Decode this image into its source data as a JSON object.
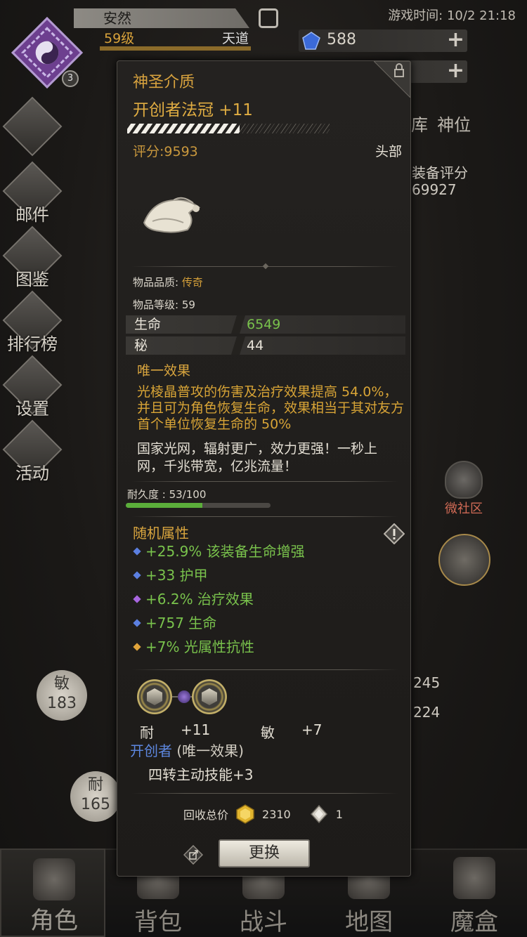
{
  "header": {
    "player_name": "安然",
    "level": "59级",
    "rank": "天道",
    "avatar_badge": "3",
    "game_time": "游戏时间: 10/2 21:18",
    "gems": "588"
  },
  "side_menu": [
    {
      "label": ""
    },
    {
      "label": "邮件"
    },
    {
      "label": "图鉴"
    },
    {
      "label": "排行榜"
    },
    {
      "label": "设置"
    },
    {
      "label": "活动"
    }
  ],
  "tabs": [
    "库",
    "神位"
  ],
  "equip_score": {
    "label": "装备评分",
    "value": "69927"
  },
  "bg_stats": {
    "agi": {
      "label": "敏",
      "value": "183"
    },
    "end": {
      "label": "耐",
      "value": "165"
    },
    "right1": "245",
    "right2": "224"
  },
  "community": {
    "label": "微社区"
  },
  "bottom_nav": [
    {
      "label": "角色"
    },
    {
      "label": "背包"
    },
    {
      "label": "战斗"
    },
    {
      "label": "地图"
    },
    {
      "label": "魔盒"
    }
  ],
  "item": {
    "quality_label": "神圣介质",
    "name": "开创者法冠 +11",
    "score": "评分:9593",
    "slot": "头部",
    "quality_line_label": "物品品质: ",
    "quality_value": "传奇",
    "item_level": "物品等级: 59",
    "stats": [
      {
        "name": "生命",
        "value": "6549",
        "color": "#79c24c"
      },
      {
        "name": "秘",
        "value": "44",
        "color": "#e8e3d8"
      }
    ],
    "unique_title": "唯一效果",
    "unique_desc": "光棱晶普攻的伤害及治疗效果提高 54.0%，并且可为角色恢复生命，效果相当于其对友方首个单位恢复生命的 50%",
    "flavor": "国家光网，辐射更广，效力更强！一秒上网，千兆带宽，亿兆流量！",
    "durability": "耐久度 : 53/100",
    "durability_fraction": 0.53,
    "random_title": "随机属性",
    "random_attrs": [
      {
        "text": "+25.9% 该装备生命增强",
        "dot": "#5b7fe0"
      },
      {
        "text": "+33 护甲",
        "dot": "#5b7fe0"
      },
      {
        "text": "+6.2% 治疗效果",
        "dot": "#a866e0"
      },
      {
        "text": "+757 生命",
        "dot": "#5b7fe0"
      },
      {
        "text": "+7% 光属性抗性",
        "dot": "#e0a33a"
      }
    ],
    "sockets": [
      {
        "stat": "耐",
        "value": "+11"
      },
      {
        "stat": "敏",
        "value": "+7"
      }
    ],
    "set_name": "开创者",
    "set_suffix": " (唯一效果)",
    "set_bonus": "四转主动技能+3",
    "recycle_label": "回收总价",
    "recycle_gold": "2310",
    "recycle_shard": "1",
    "replace_label": "更换"
  }
}
